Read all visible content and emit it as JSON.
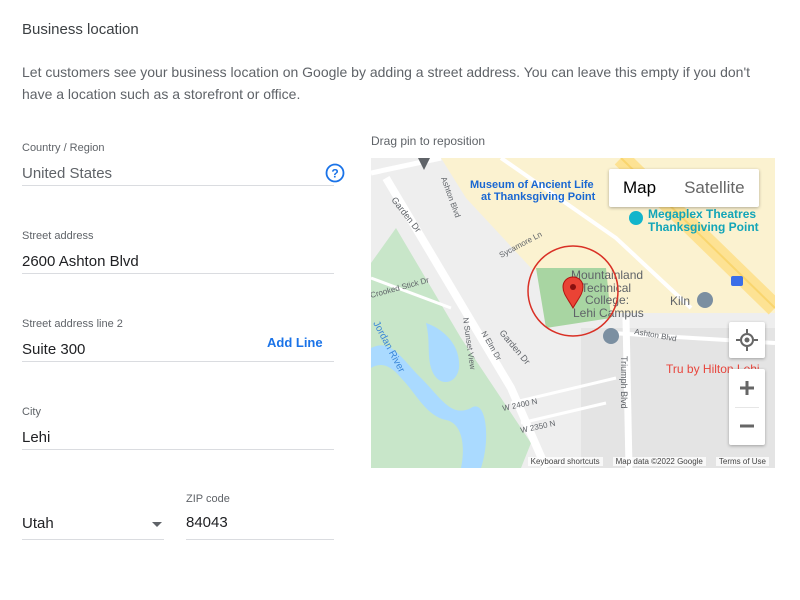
{
  "section": {
    "title": "Business location",
    "description": "Let customers see your business location on Google by adding a street address. You can leave this empty if you don't have a location such as a storefront or office."
  },
  "form": {
    "country": {
      "label": "Country / Region",
      "value": "United States"
    },
    "street": {
      "label": "Street address",
      "value": "2600 Ashton Blvd"
    },
    "street2": {
      "label": "Street address line 2",
      "value": "Suite 300",
      "add_line": "Add Line"
    },
    "city": {
      "label": "City",
      "value": "Lehi"
    },
    "state": {
      "value": "Utah"
    },
    "zip": {
      "label": "ZIP code",
      "value": "84043"
    }
  },
  "map": {
    "hint": "Drag pin to reposition",
    "type_map": "Map",
    "type_satellite": "Satellite",
    "poi": {
      "museum_1": "Museum of Ancient Life",
      "museum_2": "at Thanksgiving Point",
      "theatre_1": "Megaplex Theatres",
      "theatre_2": "Thanksgiving Point",
      "college_1": "Mountainland",
      "college_2": "Technical",
      "college_3": "College:",
      "college_4": "Lehi Campus",
      "kiln": "Kiln",
      "tru": "Tru by Hilton Lehi"
    },
    "streets": {
      "garden_dr_1": "Garden Dr",
      "garden_dr_2": "Garden Dr",
      "ashton_blvd_1": "Ashton Blvd",
      "ashton_blvd_2": "Ashton Blvd",
      "sycamore": "Sycamore Ln",
      "crooked": "Crooked Stick Dr",
      "jordan": "Jordan River",
      "sunset": "N Sunset View",
      "elm": "N Elm Dr",
      "triumph": "Triumph Blvd",
      "w2400": "W 2400 N",
      "w2350": "W 2350 N"
    },
    "attribution": {
      "shortcuts": "Keyboard shortcuts",
      "data": "Map data ©2022 Google",
      "terms": "Terms of Use"
    },
    "colors": {
      "park": "#c8e6c9",
      "highway": "#fde293",
      "water": "#aadaff",
      "pin": "#ea4335",
      "highlight": "#d93025"
    }
  }
}
